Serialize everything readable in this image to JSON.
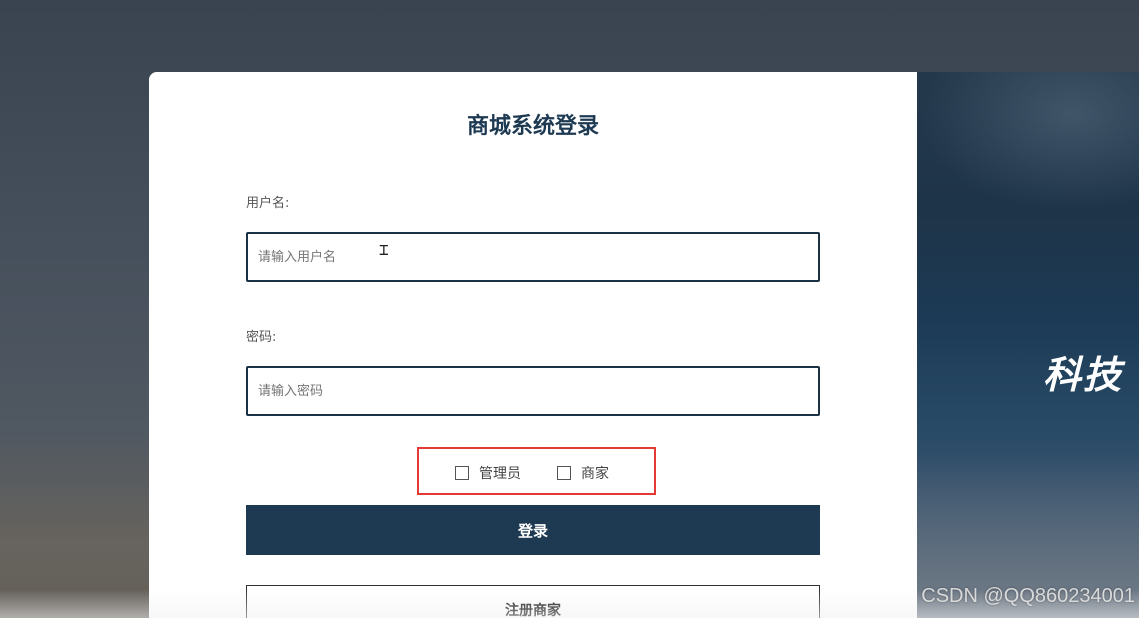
{
  "login": {
    "title": "商城系统登录",
    "username_label": "用户名:",
    "username_placeholder": "请输入用户名",
    "password_label": "密码:",
    "password_placeholder": "请输入密码",
    "roles": [
      {
        "label": "管理员",
        "checked": false
      },
      {
        "label": "商家",
        "checked": false
      }
    ],
    "login_button": "登录",
    "register_button": "注册商家"
  },
  "hero": {
    "text": "科技"
  },
  "watermark": {
    "text": "CSDN @QQ860234001"
  },
  "colors": {
    "primary": "#1d3a52",
    "highlight_border": "#e53935"
  }
}
